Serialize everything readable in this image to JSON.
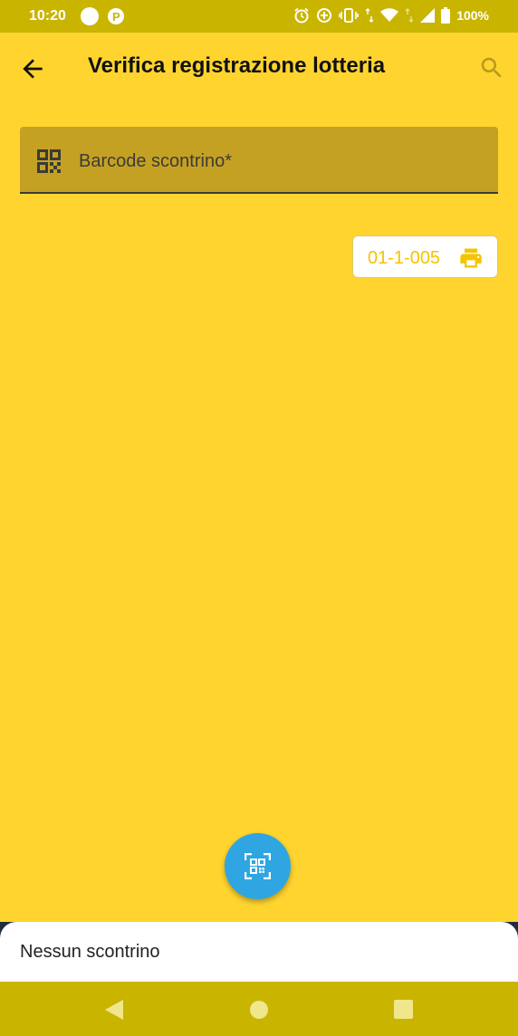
{
  "status_bar": {
    "time": "10:20",
    "battery": "100%",
    "icons": [
      "circle-icon",
      "parking-icon",
      "alarm-icon",
      "data-saver-icon",
      "vibrate-icon",
      "wifi-icon",
      "signal-icon",
      "battery-icon"
    ]
  },
  "app_bar": {
    "title": "Verifica registrazione lotteria",
    "back_icon": "arrow-back-icon",
    "search_icon": "search-icon"
  },
  "barcode_field": {
    "placeholder": "Barcode scontrino*",
    "icon": "qr-code-icon"
  },
  "device_chip": {
    "code": "01-1-005",
    "icon": "printer-icon"
  },
  "fab": {
    "icon": "qr-scan-icon"
  },
  "bottom_sheet": {
    "message": "Nessun scontrino"
  },
  "navigation": {
    "items": [
      "back-nav-icon",
      "home-nav-icon",
      "recents-nav-icon"
    ]
  },
  "colors": {
    "background": "#FFD42E",
    "status_bar": "#C9B500",
    "field": "#C4A122",
    "accent": "#F5C400",
    "fab": "#2FA6E1"
  }
}
